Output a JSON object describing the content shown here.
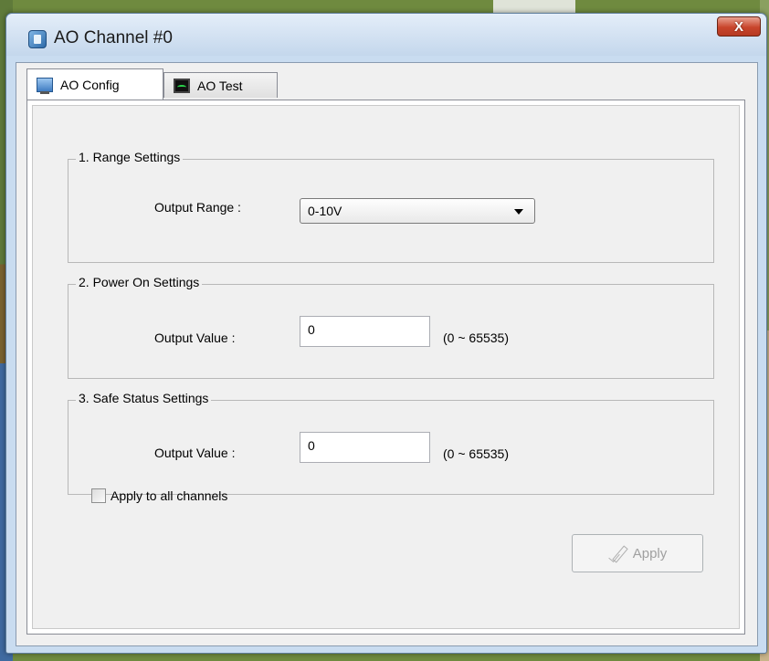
{
  "window": {
    "title": "AO Channel #0",
    "close_label": "X"
  },
  "tabs": [
    {
      "label": "AO Config",
      "icon": "monitor-config-icon",
      "active": true
    },
    {
      "label": "AO Test",
      "icon": "oscilloscope-icon",
      "active": false
    }
  ],
  "range_settings": {
    "group_title": "1. Range Settings",
    "label": "Output Range :",
    "selected": "0-10V"
  },
  "power_on_settings": {
    "group_title": "2. Power On Settings",
    "label": "Output Value :",
    "value": "0",
    "range_hint": "(0 ~ 65535)"
  },
  "safe_status_settings": {
    "group_title": "3. Safe Status Settings",
    "label": "Output Value :",
    "value": "0",
    "range_hint": "(0 ~ 65535)"
  },
  "apply_all": {
    "label": "Apply to all channels",
    "checked": false
  },
  "apply_button": {
    "label": "Apply",
    "enabled": false,
    "icon": "check-icon"
  }
}
